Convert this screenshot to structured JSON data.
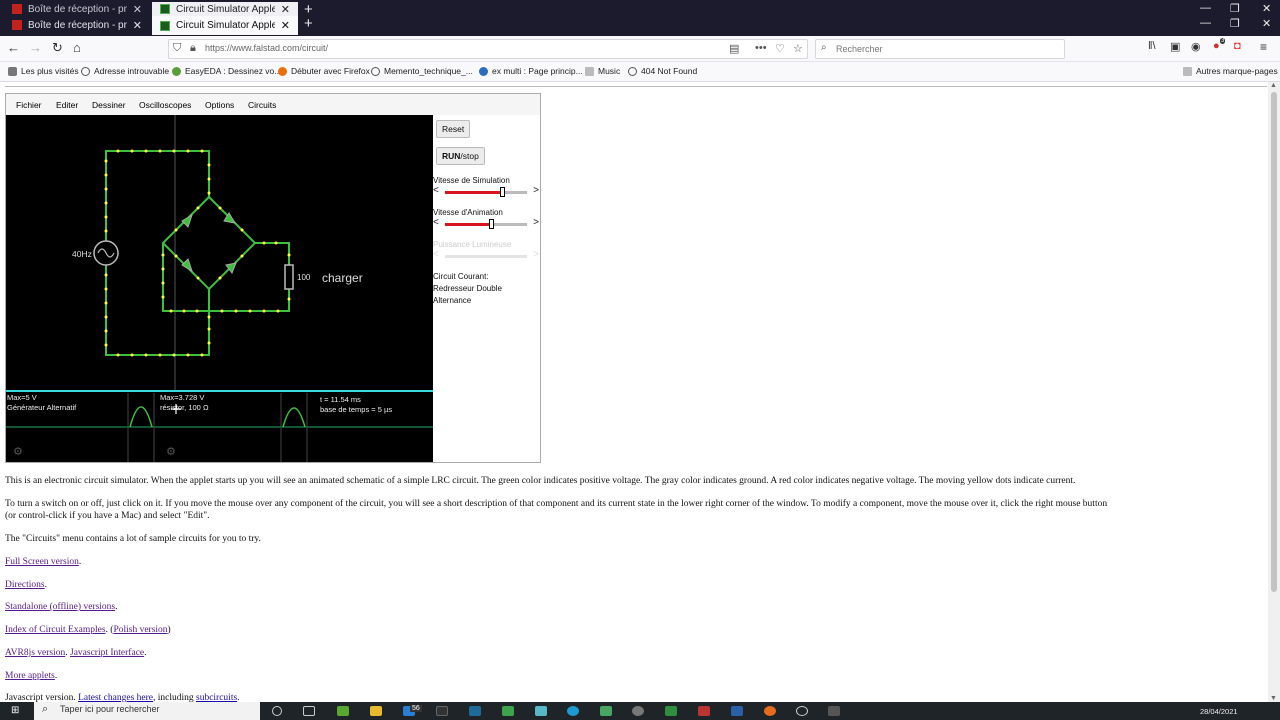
{
  "browser": {
    "tabs": [
      {
        "title": "Boîte de réception - profmeld",
        "active": false
      },
      {
        "title": "Boîte de réception - profmeld",
        "active": false
      },
      {
        "title": "Circuit Simulator Applet",
        "active": false
      },
      {
        "title": "Circuit Simulator Applet",
        "active": true
      }
    ],
    "url": "https://www.falstad.com/circuit/",
    "search_placeholder": "Rechercher",
    "notification_count": "3",
    "bookmarks": [
      "Les plus visités",
      "Adresse introuvable",
      "EasyEDA : Dessinez vo...",
      "Débuter avec Firefox",
      "Memento_technique_...",
      "ex multi : Page princip...",
      "Music",
      "404 Not Found"
    ],
    "other_bookmarks": "Autres marque-pages"
  },
  "applet": {
    "menu": [
      "Fichier",
      "Editer",
      "Dessiner",
      "Oscilloscopes",
      "Options",
      "Circuits"
    ],
    "reset_label": "Reset",
    "run_label_bold": "RUN",
    "run_label_rest": "/stop",
    "sliders": [
      {
        "label": "Vitesse de Simulation",
        "value": 0.7,
        "enabled": true
      },
      {
        "label": "Vitesse d'Animation",
        "value": 0.56,
        "enabled": true
      },
      {
        "label": "Puissance Lumineuse",
        "value": 0.5,
        "enabled": false
      }
    ],
    "circuit_info": [
      "Circuit Courant:",
      "Redresseur Double",
      "Alternance"
    ],
    "source_label": "40Hz",
    "resistor_value": "100",
    "load_label": "charger",
    "scope1": {
      "line1": "Max=5 V",
      "line2": "Générateur Alternatif"
    },
    "scope2": {
      "line1": "Max=3.728 V",
      "line2": "résistor, 100 Ω"
    },
    "time_info": {
      "line1": "t = 11.54 ms",
      "line2": "base de temps = 5 µs"
    }
  },
  "content": {
    "para1": "This is an electronic circuit simulator.  When the applet starts up you will see an animated schematic of a simple LRC circuit. The green color indicates positive voltage.  The gray color indicates ground.  A red color indicates negative voltage.  The moving yellow dots indicate current.",
    "para2a": "To turn a switch on or off, just click on it.  If you move the mouse over any component of the circuit, you will see a short description of that component and its current state in the lower right corner of the window.  To modify a component, move the mouse over it, click the right mouse button",
    "para2b": "(or control-click if you have a Mac) and select \"Edit\".",
    "para3": "The \"Circuits\" menu contains a lot of sample circuits for you to try.",
    "link_fullscreen": "Full Screen version",
    "link_directions": "Directions",
    "link_standalone": "Standalone (offline) versions",
    "link_index": "Index of Circuit Examples",
    "link_polish": "Polish version",
    "link_avr": "AVR8js version",
    "link_jsinterface": "Javascript Interface",
    "link_more": "More applets",
    "js_version_prefix": "Javascript version. ",
    "link_changes": "Latest changes here",
    "including": ", including ",
    "link_subcircuits": "subcircuits"
  },
  "taskbar": {
    "search_text": "Taper ici pour rechercher",
    "badge": "56",
    "date": "28/04/2021"
  },
  "colors": {
    "wire_green": "#3fbf3f",
    "current_dot": "#ffff40",
    "scope_cyan": "#33dddd",
    "slider_red": "#d8141e"
  }
}
